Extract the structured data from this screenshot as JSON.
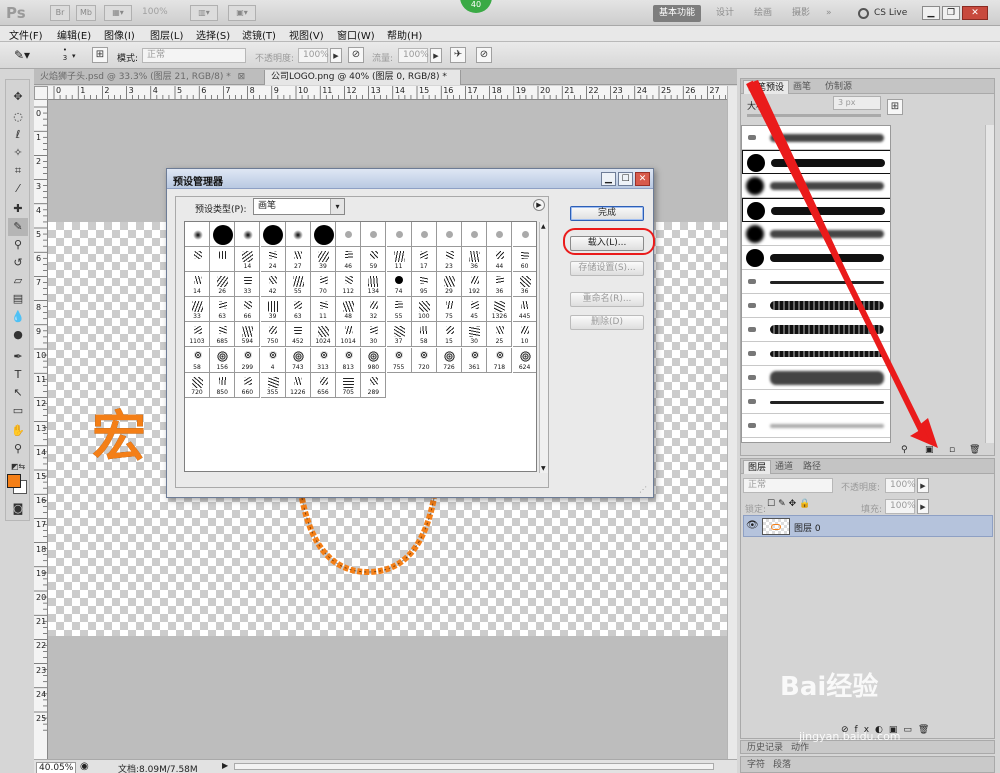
{
  "titlebar": {
    "zoom": "100%",
    "workspaces": [
      "基本功能",
      "设计",
      "绘画",
      "摄影"
    ],
    "cs_live": "CS Live",
    "badge": "40"
  },
  "menu": [
    "文件(F)",
    "编辑(E)",
    "图像(I)",
    "图层(L)",
    "选择(S)",
    "滤镜(T)",
    "视图(V)",
    "窗口(W)",
    "帮助(H)"
  ],
  "options": {
    "brush_size": "3",
    "mode_label": "模式:",
    "mode_value": "正常",
    "opacity_label": "不透明度:",
    "opacity_value": "100%",
    "flow_label": "流量:",
    "flow_value": "100%"
  },
  "tabs": [
    {
      "label": "火焰狮子头.psd @ 33.3% (图层 21, RGB/8) *",
      "close": "⊠"
    },
    {
      "label": "公司LOGO.png @ 40% (图层 0, RGB/8) *",
      "close": "⊠"
    }
  ],
  "ruler_h": [
    "0",
    "1",
    "2",
    "3",
    "4",
    "5",
    "6",
    "7",
    "8",
    "9",
    "10",
    "11",
    "12",
    "13",
    "14",
    "15",
    "16",
    "17",
    "18",
    "19",
    "20",
    "21",
    "22",
    "23",
    "24",
    "25",
    "26",
    "27"
  ],
  "ruler_v": [
    "0",
    "1",
    "2",
    "3",
    "4",
    "5",
    "6",
    "7",
    "8",
    "9",
    "10",
    "11",
    "12",
    "13",
    "14",
    "15",
    "16",
    "17",
    "18",
    "19",
    "20",
    "21",
    "22",
    "23",
    "24",
    "25"
  ],
  "status": {
    "zoom": "40.05%",
    "doc": "文档:8.09M/7.58M"
  },
  "brush_panel": {
    "tabs": [
      "画笔预设",
      "画笔",
      "仿制源"
    ],
    "size_label": "大小:",
    "size_value": "3 px"
  },
  "layers_panel": {
    "tabs": [
      "图层",
      "通道",
      "路径"
    ],
    "blend": "正常",
    "opacity_label": "不透明度:",
    "opacity_value": "100%",
    "lock_label": "锁定:",
    "fill_label": "填充:",
    "fill_value": "100%",
    "layer_name": "图层 0"
  },
  "bottom_tabs": {
    "history": "历史记录",
    "actions": "动作",
    "char": "字符",
    "para": "段落"
  },
  "dialog": {
    "title": "预设管理器",
    "type_label": "预设类型(P):",
    "type_value": "画笔",
    "buttons": {
      "done": "完成",
      "load": "载入(L)...",
      "save": "存储设置(S)...",
      "rename": "重命名(R)...",
      "delete": "删除(D)"
    },
    "grid_numbers": [
      [
        "",
        "",
        "",
        "",
        "",
        "",
        "",
        "",
        "",
        "",
        "",
        "",
        "",
        ""
      ],
      [
        "",
        "",
        "14",
        "24",
        "27",
        "39",
        "46",
        "59",
        "11",
        "17",
        "23",
        "36",
        "44",
        "60"
      ],
      [
        "14",
        "26",
        "33",
        "42",
        "55",
        "70",
        "112",
        "134",
        "74",
        "95",
        "29",
        "192",
        "36",
        "36"
      ],
      [
        "33",
        "63",
        "66",
        "39",
        "63",
        "11",
        "48",
        "32",
        "55",
        "100",
        "75",
        "45",
        "1326",
        "445"
      ],
      [
        "1103",
        "685",
        "594",
        "750",
        "452",
        "1024",
        "1014",
        "30",
        "37",
        "58",
        "15",
        "30",
        "25",
        "10"
      ],
      [
        "58",
        "156",
        "299",
        "4",
        "743",
        "313",
        "813",
        "980",
        "755",
        "720",
        "726",
        "361",
        "718",
        "624"
      ],
      [
        "720",
        "850",
        "660",
        "355",
        "1226",
        "656",
        "705",
        "289"
      ]
    ]
  },
  "watermark": {
    "brand": "Bai经验",
    "url": "jingyan.baidu.com"
  },
  "artwork": {
    "char": "宏"
  },
  "colors": {
    "accent_orange": "#f47f17",
    "annotation_red": "#ea1b1b",
    "badge_green": "#3aaa45"
  }
}
